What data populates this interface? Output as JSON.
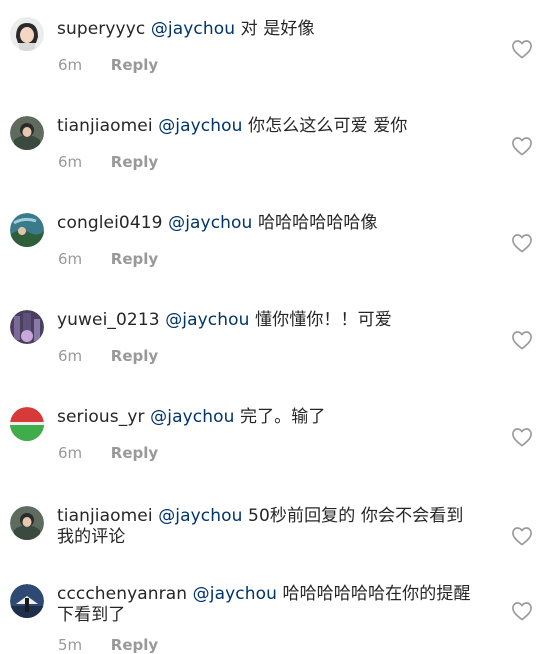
{
  "comments": [
    {
      "username": "superyyyc",
      "mention": "@jaychou",
      "text": "对 是好像",
      "time": "6m",
      "reply": "Reply"
    },
    {
      "username": "tianjiaomei",
      "mention": "@jaychou",
      "text": "你怎么这么可爱 爱你",
      "time": "6m",
      "reply": "Reply"
    },
    {
      "username": "conglei0419",
      "mention": "@jaychou",
      "text": "哈哈哈哈哈哈像",
      "time": "6m",
      "reply": "Reply"
    },
    {
      "username": "yuwei_0213",
      "mention": "@jaychou",
      "text": "懂你懂你！！可爱",
      "time": "6m",
      "reply": "Reply"
    },
    {
      "username": "serious_yr",
      "mention": "@jaychou",
      "text": "完了。输了",
      "time": "6m",
      "reply": "Reply"
    },
    {
      "username": "tianjiaomei",
      "mention": "@jaychou",
      "text": "50秒前回复的 你会不会看到我的评论",
      "time": "",
      "reply": ""
    },
    {
      "username": "cccchenyanran",
      "mention": "@jaychou",
      "text": "哈哈哈哈哈哈在你的提醒下看到了",
      "time": "5m",
      "reply": "Reply"
    }
  ],
  "icons": {
    "heart": "heart-outline-icon",
    "avatar": "avatar-photo"
  },
  "colors": {
    "username": "#262626",
    "mention": "#003569",
    "meta": "#999999",
    "heart": "#9a9a9a"
  }
}
